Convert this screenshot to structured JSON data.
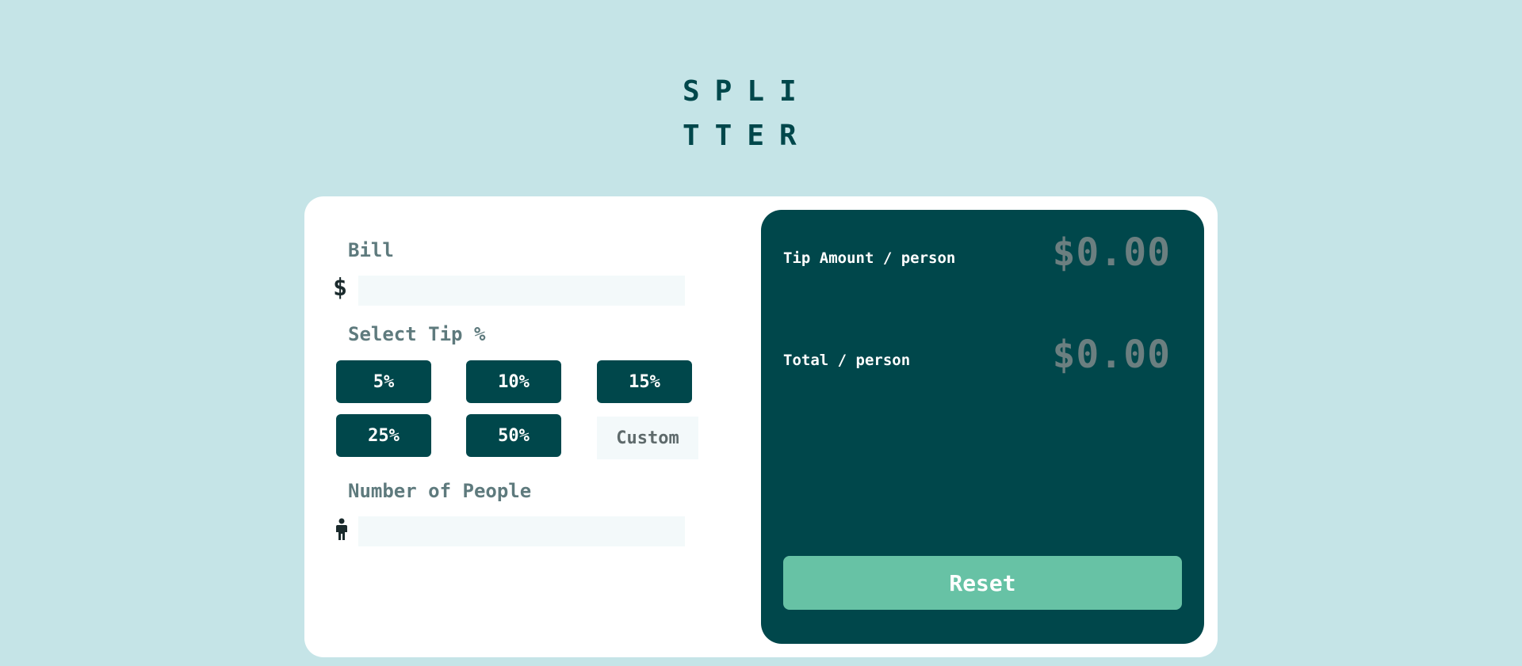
{
  "logo": {
    "line1": "SPLI",
    "line2": "TTER"
  },
  "form": {
    "bill_label": "Bill",
    "bill_prefix": "$",
    "bill_value": "",
    "tip_label": "Select Tip %",
    "tip_options": [
      "5%",
      "10%",
      "15%",
      "25%",
      "50%"
    ],
    "custom_placeholder": "Custom",
    "people_label": "Number of People",
    "people_value": ""
  },
  "results": {
    "tip_label": "Tip Amount / person",
    "tip_value": "$0.00",
    "total_label": "Total / person",
    "total_value": "$0.00",
    "reset_label": "Reset"
  },
  "icons": {
    "bill": "dollar-icon",
    "people": "person-icon"
  },
  "colors": {
    "background": "#c5e4e7",
    "card": "#ffffff",
    "primary": "#00474b",
    "accent": "#67c2a5",
    "label": "#5e7a7d",
    "input_bg": "#f3f9fa"
  }
}
